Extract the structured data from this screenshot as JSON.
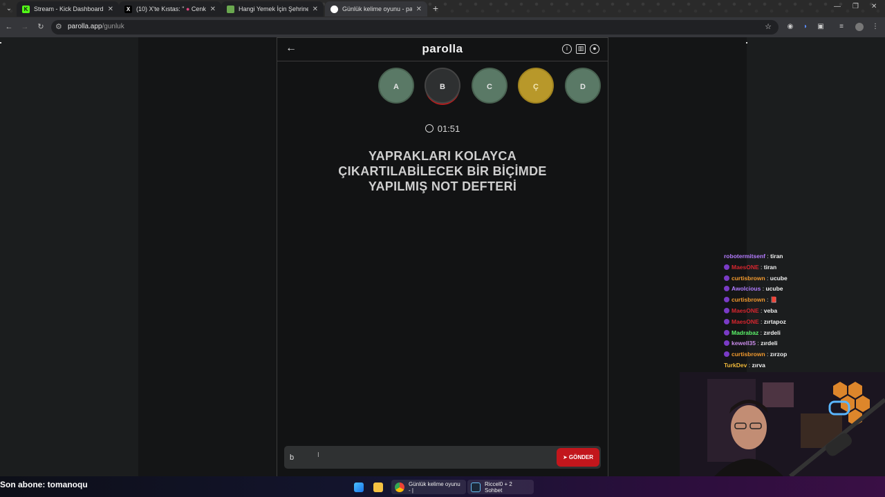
{
  "browser": {
    "tabs": [
      {
        "title": "Stream - Kick Dashboard",
        "icon": "kick-icon",
        "active": false
      },
      {
        "title": "(10) X'te Kıstas: \"",
        "title2": "Cenk Hoca",
        "icon": "x-logo-icon",
        "active": false
      },
      {
        "title": "Hangi Yemek İçin Şehrine Gider",
        "icon": "recipe-icon",
        "active": false
      },
      {
        "title": "Günlük kelime oyunu - paro",
        "icon": "parolla-icon",
        "active": true
      }
    ],
    "url_host": "parolla.app",
    "url_path": "/gunluk"
  },
  "game": {
    "brand": "parolla",
    "letters": [
      {
        "char": "A",
        "state": "correct"
      },
      {
        "char": "B",
        "state": "current"
      },
      {
        "char": "C",
        "state": "correct"
      },
      {
        "char": "Ç",
        "state": "passed"
      },
      {
        "char": "D",
        "state": "correct"
      }
    ],
    "timer": "01:51",
    "question": "YAPRAKLARI KOLAYCA ÇIKARTILABİLECEK BİR BİÇİMDE YAPILMIŞ NOT DEFTERİ",
    "answer_value": "b",
    "send_label": "GÖNDER"
  },
  "chat": [
    {
      "user": "robotermitsenf",
      "msg": "tiran",
      "color": "#b57cff",
      "badge": false
    },
    {
      "user": "MaesONE",
      "msg": "tiran",
      "color": "#d7262f",
      "badge": true
    },
    {
      "user": "curtisbrown",
      "msg": "ucube",
      "color": "#f29a2e",
      "badge": true
    },
    {
      "user": "Awolcious",
      "msg": "ucube",
      "color": "#b07cff",
      "badge": true
    },
    {
      "user": "curtisbrown",
      "msg": "📕",
      "color": "#f29a2e",
      "badge": true
    },
    {
      "user": "MaesONE",
      "msg": "veba",
      "color": "#d7262f",
      "badge": true
    },
    {
      "user": "MaesONE",
      "msg": "zırtapoz",
      "color": "#d7262f",
      "badge": true
    },
    {
      "user": "Madrabaz",
      "msg": "zırdeli",
      "color": "#5cf56a",
      "badge": true
    },
    {
      "user": "kewell35",
      "msg": "zırdeli",
      "color": "#c98ce8",
      "badge": true
    },
    {
      "user": "curtisbrown",
      "msg": "zırzop",
      "color": "#f29a2e",
      "badge": true
    },
    {
      "user": "TurkDev",
      "msg": "zırva",
      "color": "#f0b93a",
      "badge": false
    }
  ],
  "overlay": {
    "subscriber_text": "Son abone: tomanoqu"
  },
  "taskbar": {
    "apps": [
      {
        "label": "Günlük kelime oyunu - |",
        "icon": "chrome-icon"
      },
      {
        "label": "Riccel0 + 2 Sohbet",
        "icon": "steam-icon"
      }
    ]
  }
}
